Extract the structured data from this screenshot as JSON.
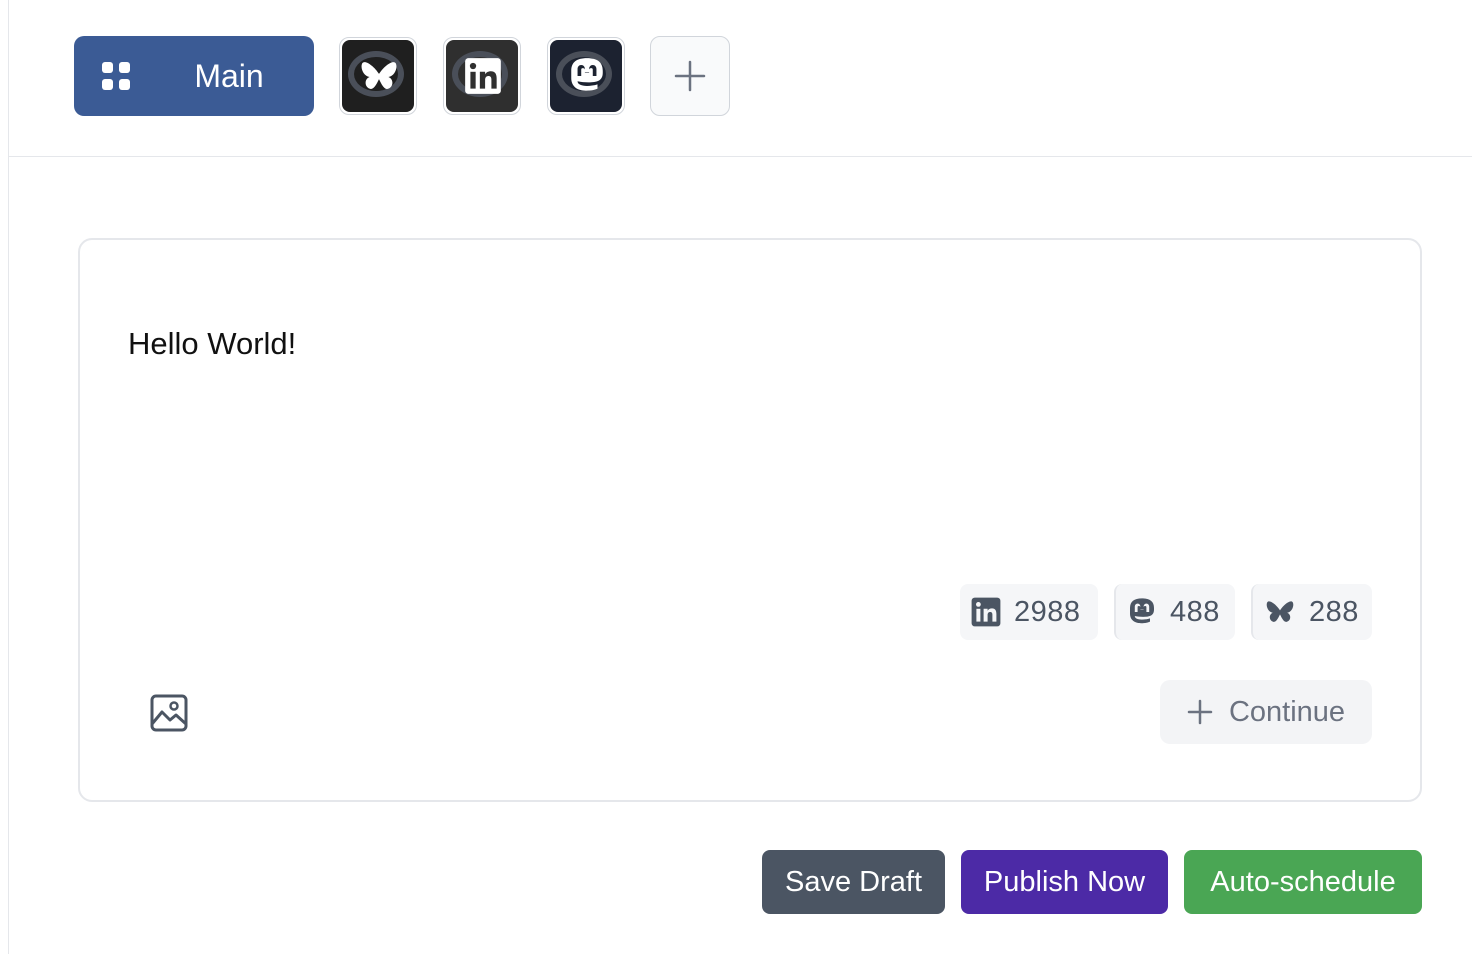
{
  "header": {
    "main_tab_label": "Main",
    "accounts": [
      {
        "name": "bluesky-account",
        "icon": "butterfly-icon"
      },
      {
        "name": "linkedin-account",
        "icon": "linkedin-icon"
      },
      {
        "name": "mastodon-account",
        "icon": "mastodon-icon"
      }
    ],
    "add_account_icon": "plus-icon"
  },
  "editor": {
    "text": "Hello World!",
    "counters": [
      {
        "platform": "linkedin",
        "icon": "linkedin-icon",
        "value": "2988"
      },
      {
        "platform": "mastodon",
        "icon": "mastodon-icon",
        "value": "488"
      },
      {
        "platform": "bluesky",
        "icon": "butterfly-icon",
        "value": "288"
      }
    ],
    "media_icon": "image-icon",
    "continue_label": "Continue"
  },
  "actions": {
    "save_draft": "Save Draft",
    "publish_now": "Publish Now",
    "auto_schedule": "Auto-schedule"
  },
  "colors": {
    "main_tab": "#3b5b95",
    "save_draft": "#4b5563",
    "publish_now": "#4c2aa6",
    "auto_schedule": "#4aa654"
  }
}
